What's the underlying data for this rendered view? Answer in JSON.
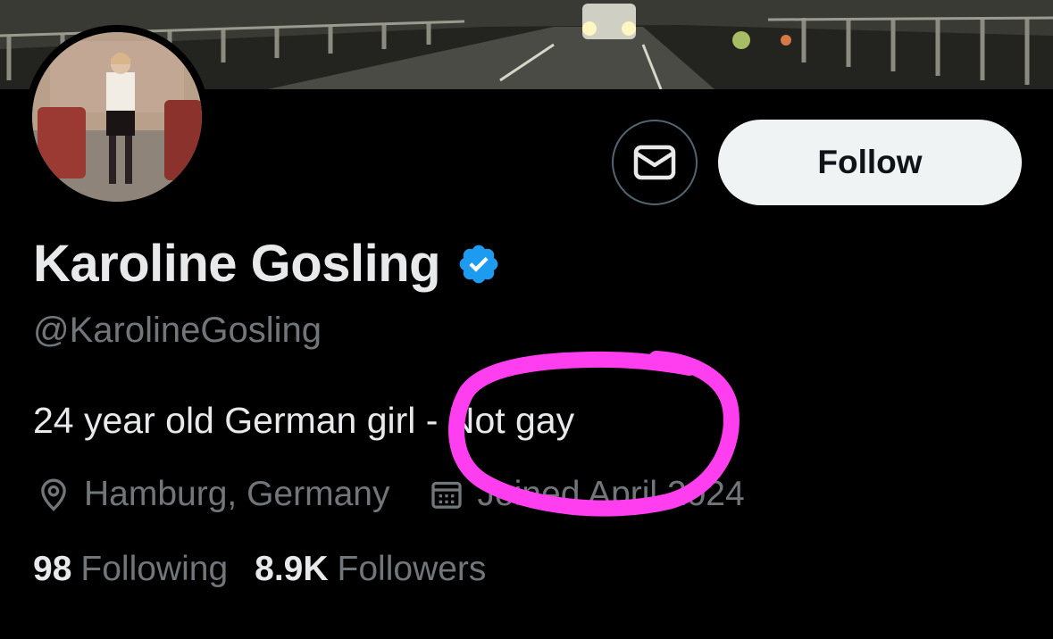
{
  "profile": {
    "display_name": "Karoline Gosling",
    "handle": "@KarolineGosling",
    "bio_prefix": "24 year old German girl - ",
    "bio_highlight": "Not gay",
    "location": "Hamburg, Germany",
    "joined": "Joined April 2024",
    "verified_icon": "verified-badge-icon",
    "verified_color": "#1d9bf0"
  },
  "actions": {
    "follow_label": "Follow",
    "message_icon": "envelope-icon"
  },
  "stats": {
    "following_count": "98",
    "following_label": "Following",
    "followers_count": "8.9K",
    "followers_label": "Followers"
  },
  "annotation": {
    "circle_color": "#ff3ef0"
  }
}
